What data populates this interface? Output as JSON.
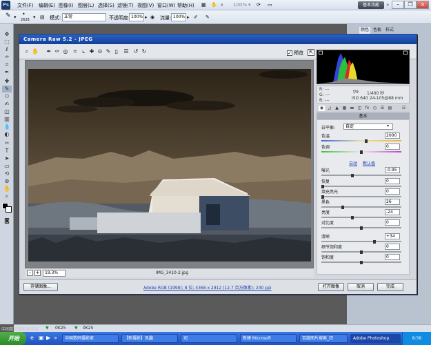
{
  "app": {
    "logo": "Ps",
    "menus": [
      "文件(F)",
      "编辑(E)",
      "图像(I)",
      "图层(L)",
      "选择(S)",
      "滤镜(T)",
      "视图(V)",
      "窗口(W)",
      "帮助(H)"
    ],
    "zoom_display": "100%",
    "workspace_button": "基本功能"
  },
  "options_bar": {
    "mode_label": "模式:",
    "mode_value": "正常",
    "opacity_label": "不透明度:",
    "opacity_value": "100%",
    "flow_label": "流量:",
    "flow_value": "100%",
    "brush_size": "2628"
  },
  "right_panel": {
    "tabs": [
      "颜色",
      "色板",
      "样式"
    ]
  },
  "doc_tabs": [
    "0K25",
    "0K25"
  ],
  "dialog": {
    "title": "Camera Raw 5.2  -  JPEG",
    "preview_label": "预览",
    "zoom_value": "19.3%",
    "filename": "IMG_3410-2.jpg",
    "workflow": "Adobe RGB (1998); 8 位; 4368 x 2912 (12.7 百万像素); 240 ppi",
    "buttons": {
      "save": "存储图像...",
      "open": "打开图像",
      "cancel": "取消",
      "done": "完成"
    },
    "exif": {
      "r": "R:  ---",
      "g": "G:  ---",
      "b": "B:  ---",
      "aperture": "f/9",
      "shutter": "1/400 秒",
      "iso": "ISO 640",
      "lens": "24-105@88 mm"
    },
    "panel_title": "基本",
    "white_balance": {
      "label": "白平衡:",
      "value": "自定"
    },
    "auto_link": "自动",
    "default_link": "默认值",
    "controls": [
      {
        "label": "色温",
        "value": "2000",
        "pos": 0.56
      },
      {
        "label": "色调",
        "value": "0",
        "pos": 0.5
      },
      {
        "label": "曝光",
        "value": "-0.95",
        "pos": 0.38
      },
      {
        "label": "恢复",
        "value": "0",
        "pos": 0.0
      },
      {
        "label": "填充亮光",
        "value": "0",
        "pos": 0.0
      },
      {
        "label": "黑色",
        "value": "26",
        "pos": 0.26
      },
      {
        "label": "亮度",
        "value": "-24",
        "pos": 0.38
      },
      {
        "label": "对比度",
        "value": "0",
        "pos": 0.5
      },
      {
        "label": "清晰",
        "value": "+34",
        "pos": 0.67
      },
      {
        "label": "细节饱和度",
        "value": "0",
        "pos": 0.5
      },
      {
        "label": "饱和度",
        "value": "0",
        "pos": 0.5
      }
    ]
  },
  "taskbar": {
    "start": "开始",
    "tasks": [
      "中国数码摄影家",
      "【新摄影】风趣",
      "润",
      "新建 Microsoft",
      "百度图片搜索_拜",
      "Adobe Photoshop"
    ],
    "clock": "8:56"
  },
  "watermark": "中国数码摄影家论坛"
}
